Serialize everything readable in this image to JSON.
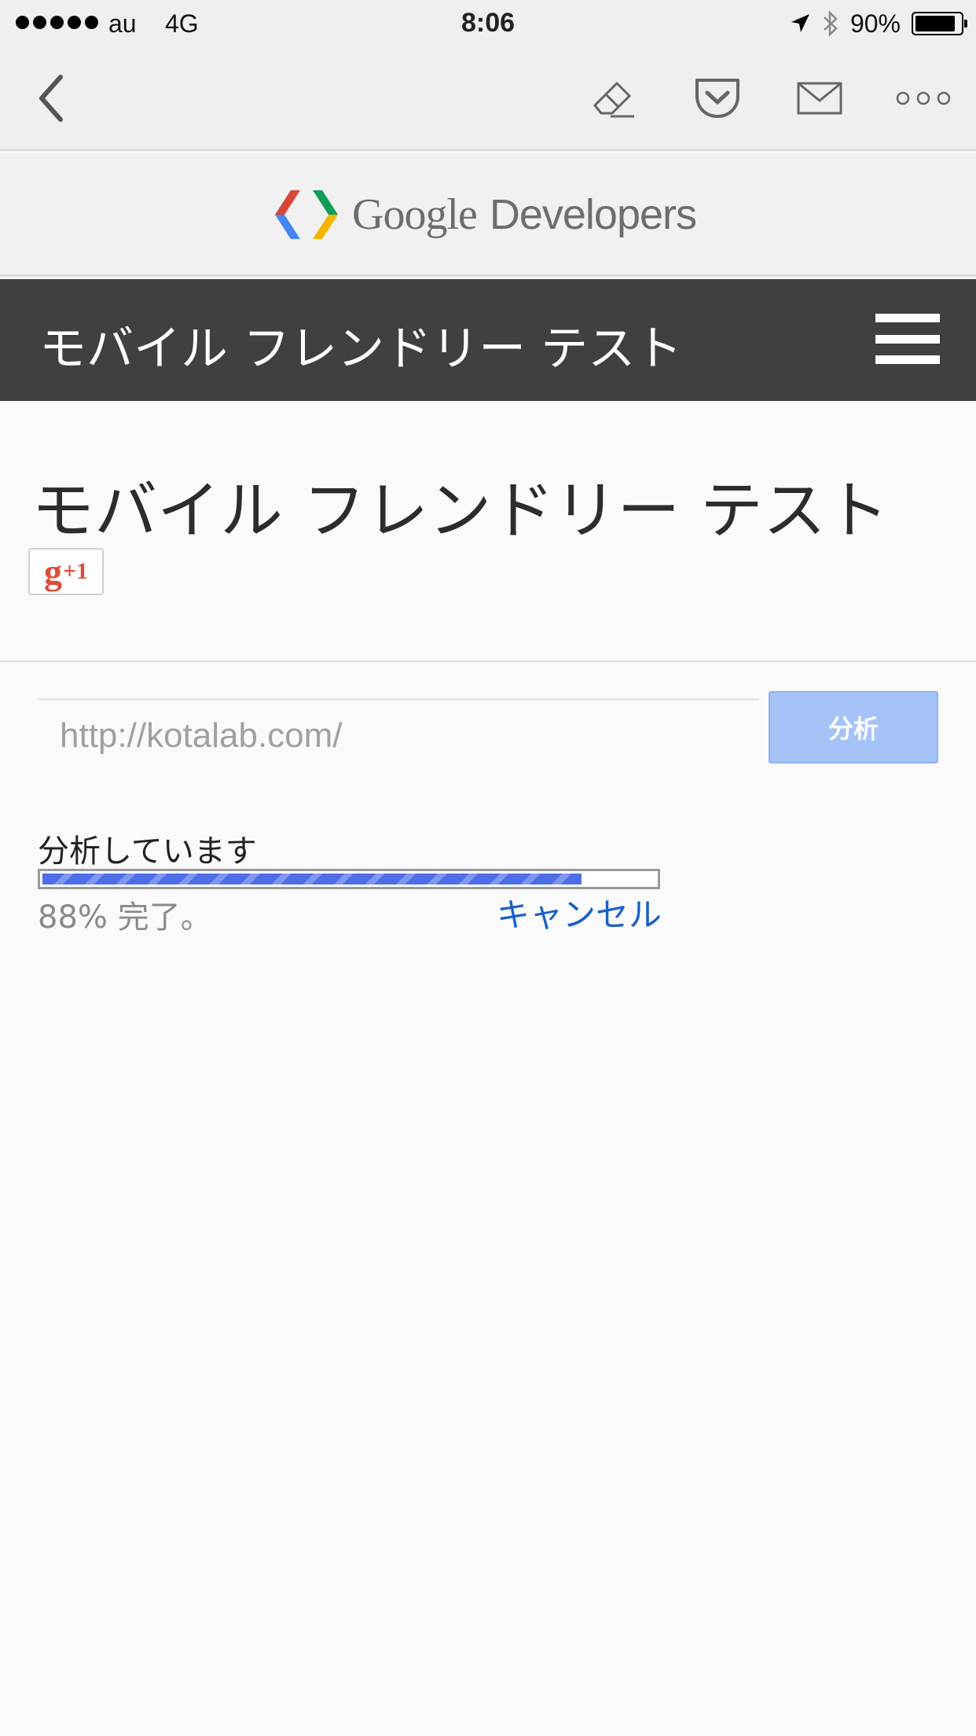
{
  "status_bar": {
    "carrier": "au",
    "network": "4G",
    "time": "8:06",
    "battery": "90%",
    "battery_level": 0.9
  },
  "toolbar": {
    "back_icon": "chevron-left-icon",
    "icons": [
      "eraser-icon",
      "pocket-icon",
      "mail-icon",
      "more-icon"
    ]
  },
  "banner": {
    "word_google": "Google",
    "word_developers": "Developers"
  },
  "header": {
    "title": "モバイル フレンドリー テスト"
  },
  "main": {
    "page_title": "モバイル フレンドリー テスト",
    "gplus_g": "g",
    "gplus_plus": "+1",
    "url_placeholder": "http://kotalab.com/",
    "analyze_button": "分析",
    "status_label": "分析しています",
    "progress": 0.88,
    "progress_text": "88% 完了。",
    "cancel_link": "キャンセル"
  },
  "colors": {
    "header_bg": "#404040",
    "button_bg": "#a5c3f7",
    "progress_fill": "#4e6ee8",
    "link": "#1a5fc9",
    "gplus_red": "#dd4b39"
  }
}
